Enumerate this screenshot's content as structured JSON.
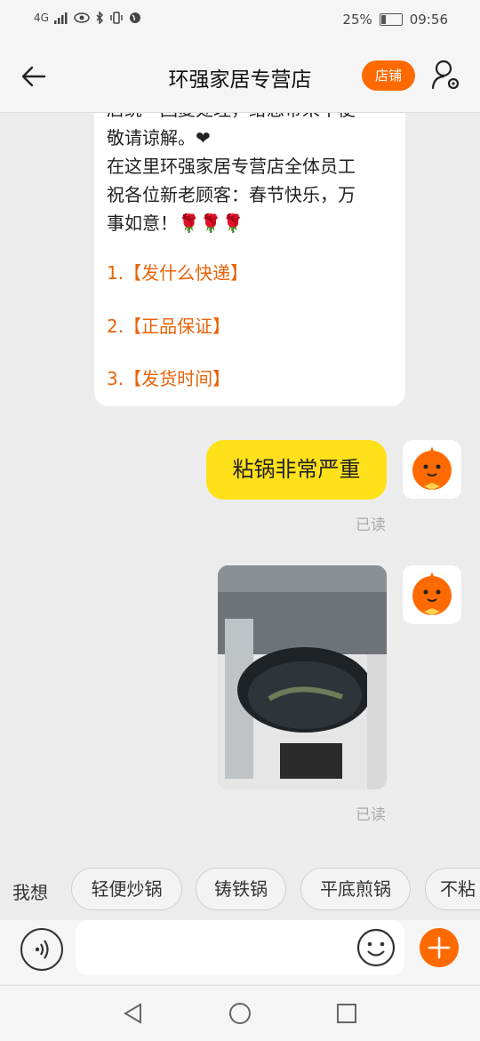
{
  "status_bar": {
    "network": "4G",
    "battery": "25%",
    "time": "09:56"
  },
  "header": {
    "title": "环强家居专营店",
    "shop_button": "店铺"
  },
  "messages": {
    "card_lines": [
      "店统一回复处理，给您带来不便",
      "敬请谅解。❤",
      "在这里环强家居专营店全体员工",
      "祝各位新老顾客：春节快乐，万",
      "事如意！🌹🌹🌹"
    ],
    "card_links": [
      "1.【发什么快递】",
      "2.【正品保证】",
      "3.【发货时间】"
    ],
    "user_message": "粘锅非常严重",
    "read_status_1": "已读",
    "read_status_2": "已读",
    "photo_icon": "wok-photo"
  },
  "suggestions": {
    "label": "我想",
    "chips": [
      "轻便炒锅",
      "铸铁锅",
      "平底煎锅",
      "不粘"
    ]
  },
  "input": {
    "placeholder": ""
  },
  "colors": {
    "accent": "#ff6a00",
    "bubble": "#ffe11a",
    "link": "#e8630a"
  }
}
